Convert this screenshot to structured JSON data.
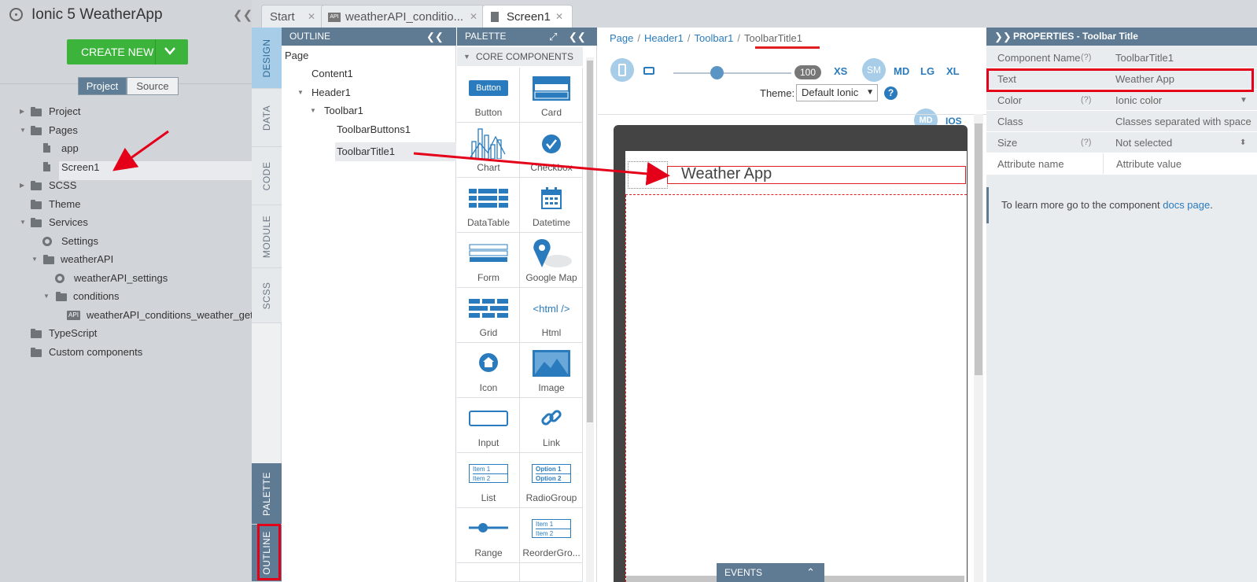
{
  "project": {
    "title": "Ionic 5 WeatherApp",
    "create_label": "CREATE NEW",
    "view_tabs": [
      "Project",
      "Source"
    ],
    "tree": [
      "Project",
      "Pages",
      "app",
      "Screen1",
      "SCSS",
      "Theme",
      "Services",
      "Settings",
      "weatherAPI",
      "weatherAPI_settings",
      "conditions",
      "weatherAPI_conditions_weather_get",
      "TypeScript",
      "Custom components"
    ],
    "api_badge": "API"
  },
  "side_tabs": {
    "design": "DESIGN",
    "data": "DATA",
    "code": "CODE",
    "module": "MODULE",
    "scss": "SCSS",
    "palette": "PALETTE",
    "outline": "OUTLINE"
  },
  "editor_tabs": {
    "start": "Start",
    "api": "weatherAPI_conditio...",
    "screen": "Screen1",
    "api_badge": "API"
  },
  "outline": {
    "title": "OUTLINE",
    "items": [
      "Page",
      "Content1",
      "Header1",
      "Toolbar1",
      "ToolbarButtons1",
      "ToolbarTitle1"
    ]
  },
  "palette": {
    "title": "PALETTE",
    "section": "CORE COMPONENTS",
    "items": [
      "Button",
      "Card",
      "Chart",
      "Checkbox",
      "DataTable",
      "Datetime",
      "Form",
      "Google Map",
      "Grid",
      "Html",
      "Icon",
      "Image",
      "Input",
      "Link",
      "List",
      "RadioGroup",
      "Range",
      "ReorderGro..."
    ],
    "button_icon_text": "Button",
    "html_icon_text": "<html />",
    "list_icon_items": [
      "Item 1",
      "Item 2"
    ],
    "radio_icon_items": [
      "Option 1",
      "Option 2"
    ],
    "reorder_icon_items": [
      "Item 1",
      "Item 2"
    ]
  },
  "canvas": {
    "breadcrumb": [
      "Page",
      "Header1",
      "Toolbar1",
      "ToolbarTitle1"
    ],
    "zoom": "100",
    "zoom_fraction": 0.37,
    "breakpoints": [
      "XS",
      "SM",
      "MD",
      "LG",
      "XL"
    ],
    "theme_label": "Theme:",
    "theme_value": "Default Ionic",
    "help": "?",
    "modes": [
      "MD",
      "IOS"
    ],
    "toolbar_title": "Weather App",
    "events": "EVENTS"
  },
  "properties": {
    "title": "PROPERTIES - Toolbar Title",
    "rows": [
      {
        "key": "Component Name",
        "hint": "(?)",
        "value": "ToolbarTitle1"
      },
      {
        "key": "Text",
        "hint": "",
        "value": "Weather App"
      },
      {
        "key": "Color",
        "hint": "(?)",
        "value": "Ionic color"
      },
      {
        "key": "Class",
        "hint": "",
        "value": "Classes separated with space"
      },
      {
        "key": "Size",
        "hint": "(?)",
        "value": "Not selected"
      },
      {
        "key": "Attribute name",
        "hint": "",
        "value": "Attribute value"
      }
    ],
    "learn_prefix": "To learn more go to the component ",
    "learn_link": "docs page",
    "learn_suffix": "."
  },
  "colors": {
    "accent": "#2a7bbd",
    "panel_header": "#5f7a93",
    "create_green": "#3cb43c",
    "highlight_red": "#e5001a"
  }
}
